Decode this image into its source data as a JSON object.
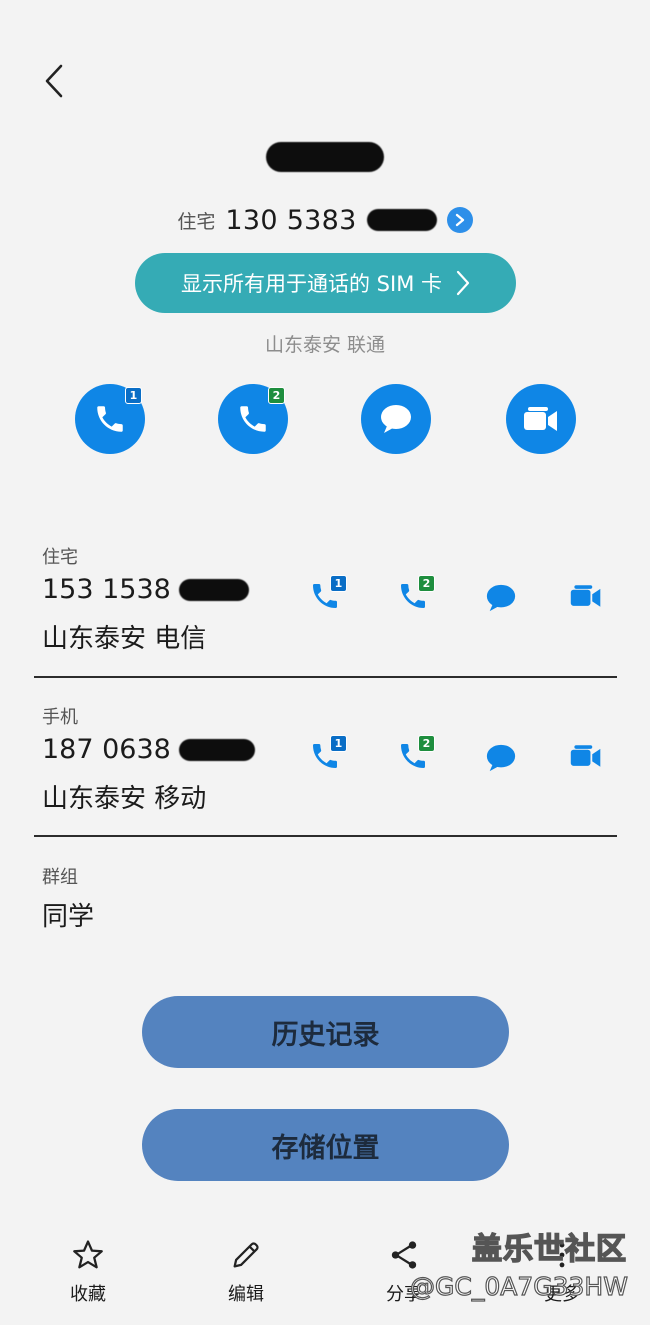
{
  "header": {
    "back_icon": "chevron-left-icon",
    "contact_name": "",
    "primary_label": "住宅",
    "primary_number": "130 5383"
  },
  "sim_banner": {
    "label": "显示所有用于通话的 SIM 卡"
  },
  "location": "山东泰安 联通",
  "quick_actions": [
    {
      "icon": "phone-sim1-icon",
      "badge": "1"
    },
    {
      "icon": "phone-sim2-icon",
      "badge": "2"
    },
    {
      "icon": "message-icon"
    },
    {
      "icon": "video-call-icon"
    }
  ],
  "entries": [
    {
      "label": "住宅",
      "number": "153 1538",
      "location": "山东泰安 电信"
    },
    {
      "label": "手机",
      "number": "187 0638",
      "location": "山东泰安 移动"
    }
  ],
  "row_badges": {
    "sim1": "1",
    "sim2": "2"
  },
  "group": {
    "label": "群组",
    "value": "同学"
  },
  "buttons": {
    "history": "历史记录",
    "storage": "存储位置"
  },
  "bottom_nav": {
    "favorite": "收藏",
    "edit": "编辑",
    "share": "分享",
    "more": "更多"
  },
  "watermark": {
    "brand": "盖乐世社区",
    "id": "@GC_0A7G33HW"
  },
  "colors": {
    "accent_blue": "#0f86e6",
    "sim_pill": "#35abb5",
    "big_button": "#5483bf",
    "sim1_badge": "#0a6ec6",
    "sim2_badge": "#1e8e3e"
  }
}
